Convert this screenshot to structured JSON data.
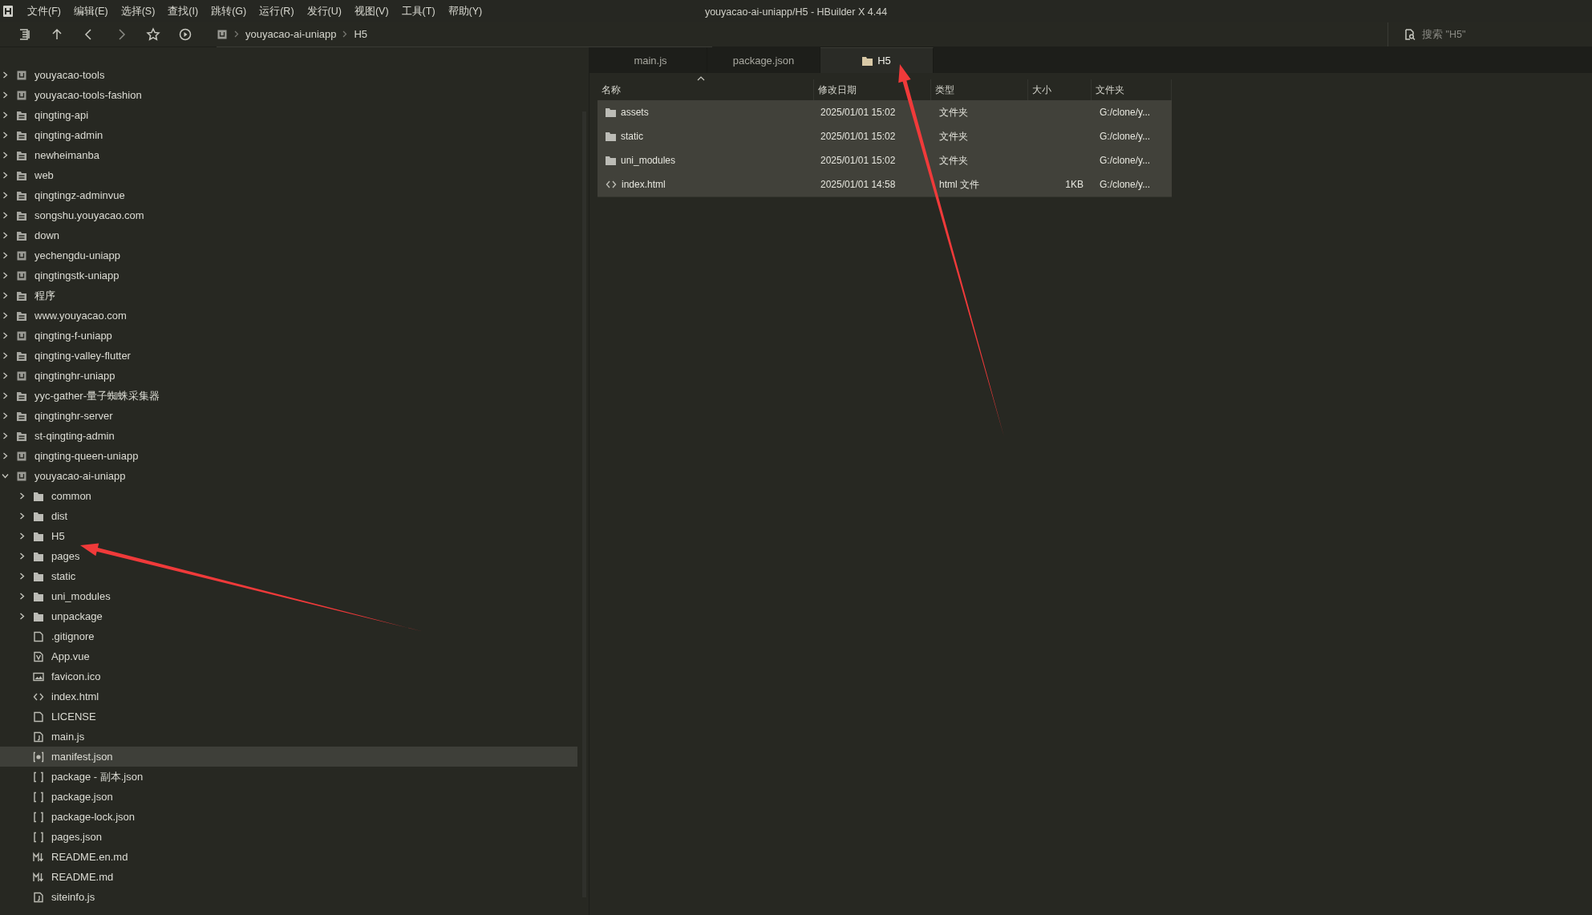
{
  "menu": [
    "文件(F)",
    "编辑(E)",
    "选择(S)",
    "查找(I)",
    "跳转(G)",
    "运行(R)",
    "发行(U)",
    "视图(V)",
    "工具(T)",
    "帮助(Y)"
  ],
  "window": {
    "title": "youyacao-ai-uniapp/H5 - HBuilder X 4.44"
  },
  "toolbar": {
    "breadcrumb": [
      "youyacao-ai-uniapp",
      "H5"
    ],
    "search": {
      "placeholder": "搜索 \"H5\""
    }
  },
  "sidebar": {
    "tree": [
      {
        "label": "youyacao-tools",
        "kind": "project",
        "expanded": false,
        "selected": false
      },
      {
        "label": "youyacao-tools-fashion",
        "kind": "project",
        "expanded": false,
        "selected": false
      },
      {
        "label": "qingting-api",
        "kind": "dir",
        "expanded": false,
        "selected": false
      },
      {
        "label": "qingting-admin",
        "kind": "dir",
        "expanded": false,
        "selected": false
      },
      {
        "label": "newheimanba",
        "kind": "dir",
        "expanded": false,
        "selected": false
      },
      {
        "label": "web",
        "kind": "dir",
        "expanded": false,
        "selected": false
      },
      {
        "label": "qingtingz-adminvue",
        "kind": "dir",
        "expanded": false,
        "selected": false
      },
      {
        "label": "songshu.youyacao.com",
        "kind": "dir",
        "expanded": false,
        "selected": false
      },
      {
        "label": "down",
        "kind": "dir",
        "expanded": false,
        "selected": false
      },
      {
        "label": "yechengdu-uniapp",
        "kind": "project",
        "expanded": false,
        "selected": false
      },
      {
        "label": "qingtingstk-uniapp",
        "kind": "project",
        "expanded": false,
        "selected": false
      },
      {
        "label": "程序",
        "kind": "dir",
        "expanded": false,
        "selected": false
      },
      {
        "label": "www.youyacao.com",
        "kind": "dir",
        "expanded": false,
        "selected": false
      },
      {
        "label": "qingting-f-uniapp",
        "kind": "project",
        "expanded": false,
        "selected": false
      },
      {
        "label": "qingting-valley-flutter",
        "kind": "dir",
        "expanded": false,
        "selected": false
      },
      {
        "label": "qingtinghr-uniapp",
        "kind": "project",
        "expanded": false,
        "selected": false
      },
      {
        "label": "yyc-gather-量子蜘蛛采集器",
        "kind": "dir",
        "expanded": false,
        "selected": false
      },
      {
        "label": "qingtinghr-server",
        "kind": "dir",
        "expanded": false,
        "selected": false
      },
      {
        "label": "st-qingting-admin",
        "kind": "dir",
        "expanded": false,
        "selected": false
      },
      {
        "label": "qingting-queen-uniapp",
        "kind": "project",
        "expanded": false,
        "selected": false
      },
      {
        "label": "youyacao-ai-uniapp",
        "kind": "project",
        "expanded": true,
        "selected": false,
        "children": [
          {
            "label": "common",
            "kind": "folder",
            "expanded": false,
            "selected": false
          },
          {
            "label": "dist",
            "kind": "folder",
            "expanded": false,
            "selected": false
          },
          {
            "label": "H5",
            "kind": "folder",
            "expanded": false,
            "selected": false
          },
          {
            "label": "pages",
            "kind": "folder",
            "expanded": false,
            "selected": false
          },
          {
            "label": "static",
            "kind": "folder",
            "expanded": false,
            "selected": false
          },
          {
            "label": "uni_modules",
            "kind": "folder",
            "expanded": false,
            "selected": false
          },
          {
            "label": "unpackage",
            "kind": "folder",
            "expanded": false,
            "selected": false
          },
          {
            "label": ".gitignore",
            "kind": "file",
            "selected": false
          },
          {
            "label": "App.vue",
            "kind": "vue",
            "selected": false
          },
          {
            "label": "favicon.ico",
            "kind": "image",
            "selected": false
          },
          {
            "label": "index.html",
            "kind": "html",
            "selected": false
          },
          {
            "label": "LICENSE",
            "kind": "file",
            "selected": false
          },
          {
            "label": "main.js",
            "kind": "js",
            "selected": false
          },
          {
            "label": "manifest.json",
            "kind": "manifest",
            "selected": true
          },
          {
            "label": "package - 副本.json",
            "kind": "json",
            "selected": false
          },
          {
            "label": "package.json",
            "kind": "json",
            "selected": false
          },
          {
            "label": "package-lock.json",
            "kind": "json",
            "selected": false
          },
          {
            "label": "pages.json",
            "kind": "json",
            "selected": false
          },
          {
            "label": "README.en.md",
            "kind": "md",
            "selected": false
          },
          {
            "label": "README.md",
            "kind": "md",
            "selected": false
          },
          {
            "label": "siteinfo.js",
            "kind": "js",
            "selected": false
          }
        ]
      }
    ]
  },
  "tabs": [
    {
      "label": "main.js",
      "kind": "file",
      "selected": false
    },
    {
      "label": "package.json",
      "kind": "file",
      "selected": false
    },
    {
      "label": "H5",
      "kind": "folder",
      "selected": true
    }
  ],
  "table": {
    "columns": [
      {
        "label": "名称",
        "sorted": true
      },
      {
        "label": "修改日期",
        "sorted": false
      },
      {
        "label": "类型",
        "sorted": false
      },
      {
        "label": "大小",
        "sorted": false
      },
      {
        "label": "文件夹",
        "sorted": false
      }
    ],
    "rows": [
      {
        "kind": "folder",
        "cells": [
          "assets",
          "2025/01/01 15:02",
          "文件夹",
          "",
          "G:/clone/y..."
        ]
      },
      {
        "kind": "folder",
        "cells": [
          "static",
          "2025/01/01 15:02",
          "文件夹",
          "",
          "G:/clone/y..."
        ]
      },
      {
        "kind": "folder",
        "cells": [
          "uni_modules",
          "2025/01/01 15:02",
          "文件夹",
          "",
          "G:/clone/y..."
        ]
      },
      {
        "kind": "html",
        "cells": [
          "index.html",
          "2025/01/01 14:58",
          "html 文件",
          "1KB",
          "G:/clone/y..."
        ]
      }
    ]
  }
}
